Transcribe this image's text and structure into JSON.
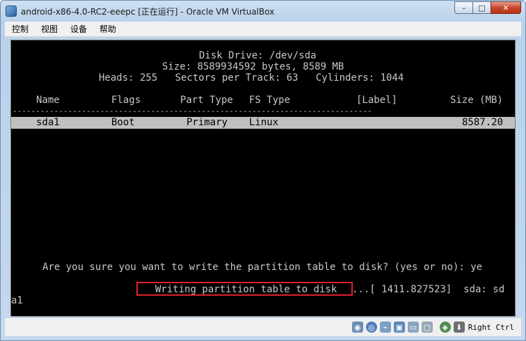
{
  "window": {
    "title": "android-x86-4.0-RC2-eeepc [正在运行] - Oracle VM VirtualBox",
    "controls": {
      "minimize": "–",
      "maximize": "□",
      "close": "✕"
    }
  },
  "menu": {
    "items": [
      {
        "label": "控制"
      },
      {
        "label": "视图"
      },
      {
        "label": "设备"
      },
      {
        "label": "帮助"
      }
    ]
  },
  "terminal": {
    "header_line1": "Disk Drive: /dev/sda",
    "header_line2": "Size: 8589934592 bytes, 8589 MB",
    "header_line3": "Heads: 255   Sectors per Track: 63   Cylinders: 1044",
    "columns": {
      "name": "Name",
      "flags": "Flags",
      "part_type": "Part Type",
      "fs_type": "FS Type",
      "label": "[Label]",
      "size": "Size (MB)"
    },
    "separator": "------------------------------------------------------------------------------",
    "row": {
      "name": "sda1",
      "flags": "Boot",
      "part_type": "Primary",
      "fs_type": "Linux",
      "label": "",
      "size": "8587.20"
    },
    "prompt": "Are you sure you want to write the partition table to disk? (yes or no): ye",
    "writing": "Writing partition table to disk",
    "kernel_msg": "...[ 1411.827523]  sda: sd",
    "wrap_line": "a1",
    "highlight_color": "#e0202a"
  },
  "statusbar": {
    "icons": [
      "hard-disk-icon",
      "optical-drive-icon",
      "usb-icon",
      "shared-folders-icon",
      "display-icon",
      "video-capture-icon",
      "network-icon",
      "mouse-integration-icon"
    ],
    "host_key": "Right Ctrl"
  }
}
